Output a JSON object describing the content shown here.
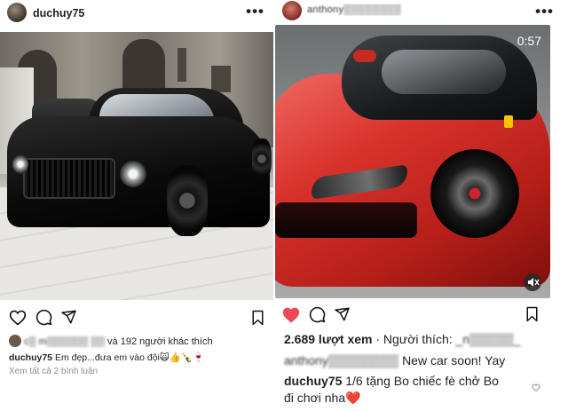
{
  "left_post": {
    "username": "duchuy75",
    "more_label": "•••",
    "likes": {
      "blurred_name": "c▒ m▒▒▒▒▒▒ ▒▒",
      "count_text": "và 192 người khác thích"
    },
    "caption": {
      "username": "duchuy75",
      "text": "Em đẹp...đưa em vào đội🙀👍🍾🍷"
    },
    "view_comments": "Xem tất cả 2 bình luận"
  },
  "right_post": {
    "username": "anthony▒▒▒▒▒▒▒▒",
    "more_label": "•••",
    "video_timer": "0:57",
    "views": "2.689 lượt xem",
    "liked_by_prefix": "· Người thích:",
    "liked_by_name": "_n▒▒▒▒▒_",
    "comment": {
      "username": "anthony▒▒▒▒▒▒▒▒",
      "text": "New car soon! Yay"
    },
    "caption": {
      "username": "duchuy75",
      "text_line1": "1/6 tặng Bo chiếc fè chở Bo",
      "text_line2": "đi chơi nha❤️"
    }
  },
  "colors": {
    "like_red": "#ed4956",
    "text": "#222222",
    "muted": "#8e8e8e"
  },
  "icons": [
    "heart-icon",
    "comment-icon",
    "share-icon",
    "bookmark-icon",
    "mute-icon",
    "more-icon",
    "small-heart-icon"
  ]
}
